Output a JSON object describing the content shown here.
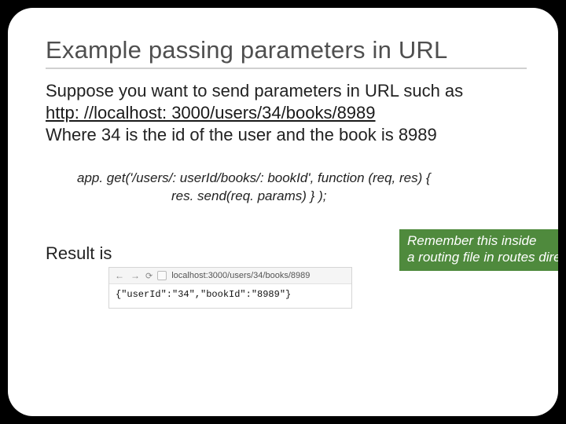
{
  "title": "Example passing parameters in URL",
  "body": {
    "line1": "Suppose you want to send parameters in URL such as",
    "url": "http: //localhost: 3000/users/34/books/8989",
    "line2": "Where 34 is the id of the user  and the book is 8989"
  },
  "code": {
    "line1": "app. get('/users/: userId/books/: bookId', function (req, res) {",
    "line2": "res. send(req. params) } );"
  },
  "callout": {
    "line1": "Remember this inside",
    "line2": "a routing file in routes direct"
  },
  "result_label": "Result is",
  "browser": {
    "address": "localhost:3000/users/34/books/8989",
    "output": "{\"userId\":\"34\",\"bookId\":\"8989\"}"
  }
}
